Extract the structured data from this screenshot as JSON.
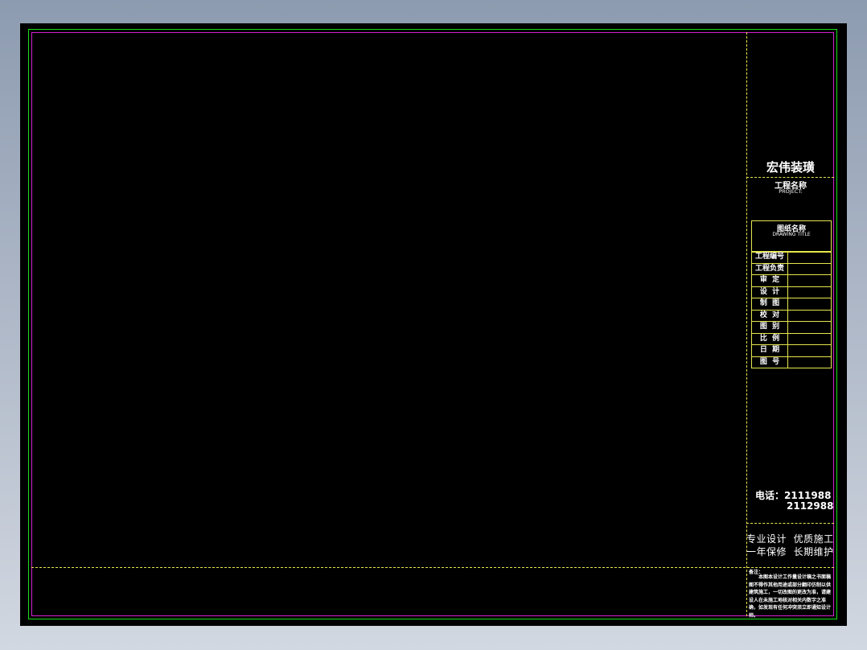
{
  "title_block": {
    "company": "宏伟装璜",
    "project_label_zh": "工程名称",
    "project_label_en": "PROJECT:",
    "drawing_title_zh": "图纸名称",
    "drawing_title_en": "DRAWING TITLE",
    "rows": [
      {
        "label": "工程编号"
      },
      {
        "label": "工程负责"
      },
      {
        "label": "审  定"
      },
      {
        "label": "设  计"
      },
      {
        "label": "制  图"
      },
      {
        "label": "校  对"
      },
      {
        "label": "图  别"
      },
      {
        "label": "比  例"
      },
      {
        "label": "日  期"
      },
      {
        "label": "图  号"
      }
    ],
    "phone_line1": "电话：2111988",
    "phone_line2": "2112988",
    "slogan_line1": "专业设计  优质施工",
    "slogan_line2": "一年保修  长期维护",
    "notes_title": "备注：",
    "notes_body": "本图本设计工作量设计稿之书面稿图不得作其他用途或部分翻印仿制以供建筑施工，一切改图的更改为准，请建设人在未施工地核对相关内数字之准确，如发现有任何冲突须立即通知设计师。"
  },
  "colors": {
    "background": "#000000",
    "outer_frame": "#18e018",
    "inner_frame": "#d21fd2",
    "table_lines": "#e6e64c",
    "text": "#ffffff"
  }
}
